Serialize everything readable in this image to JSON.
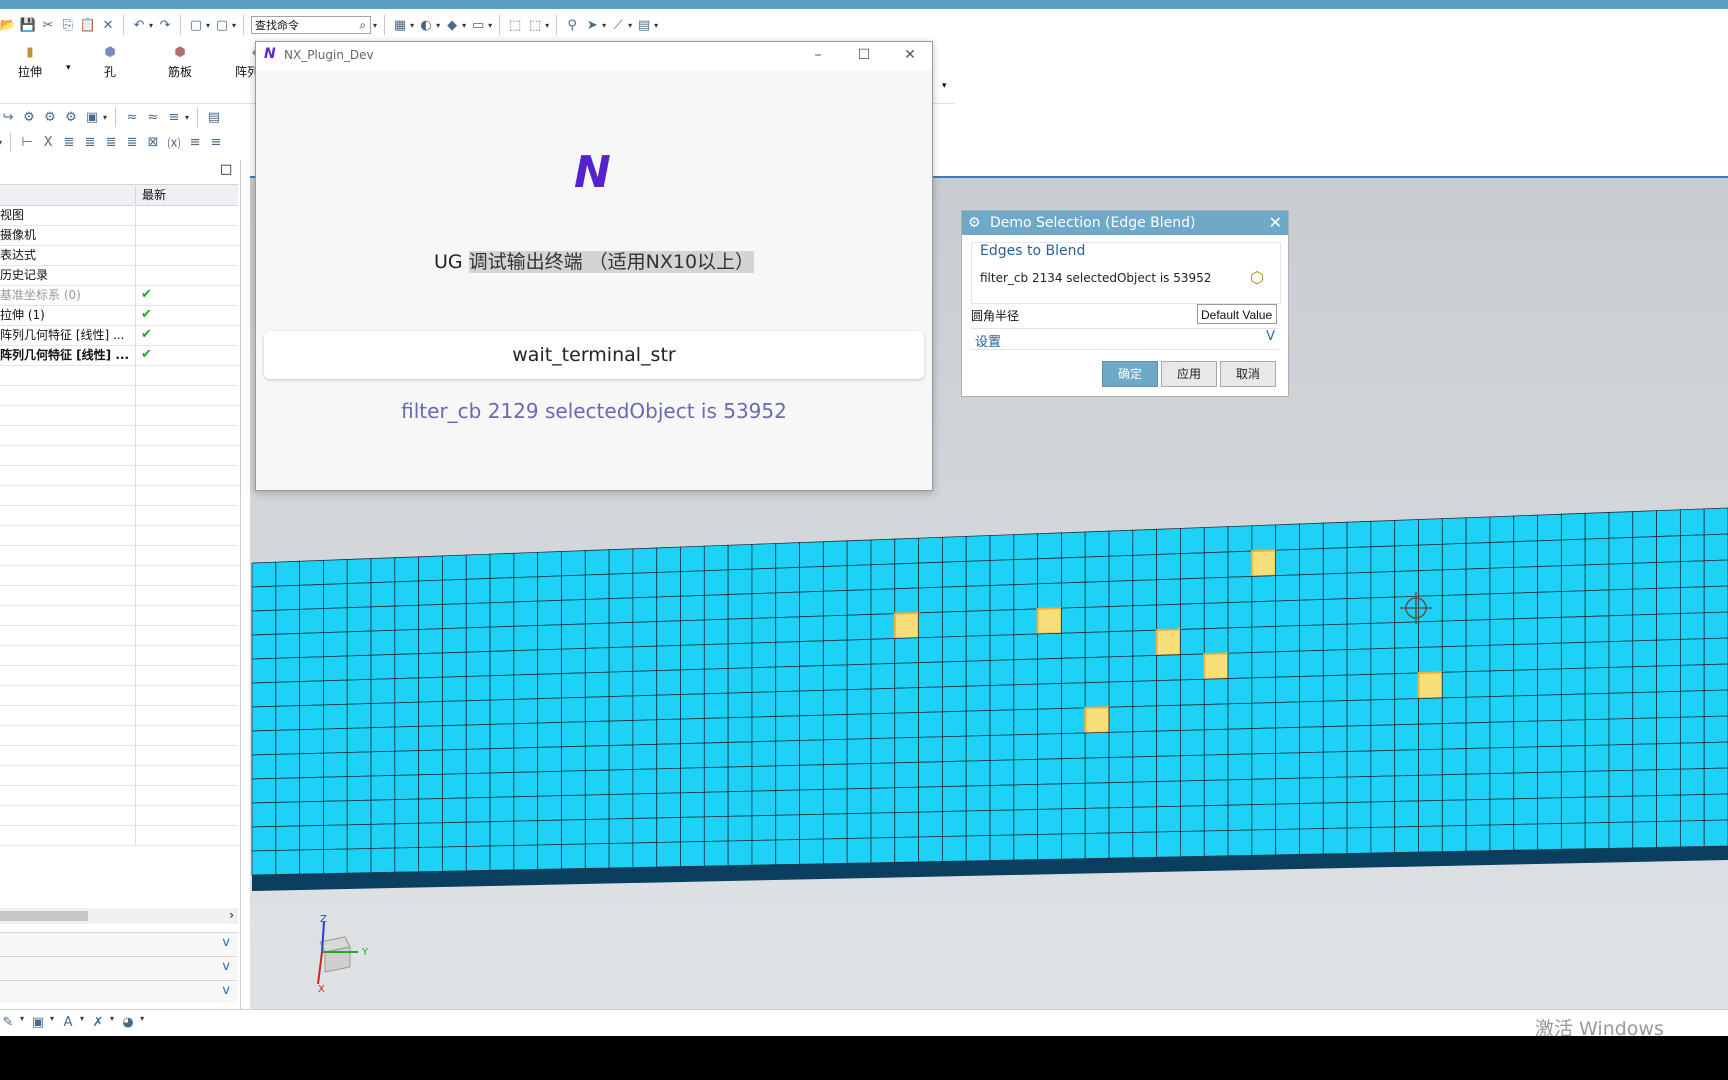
{
  "toolbar": {
    "search_value": "查找命令"
  },
  "ribbon": {
    "buttons": [
      {
        "label": "拉伸"
      },
      {
        "label": "孔"
      },
      {
        "label": "筋板"
      },
      {
        "label": "阵列"
      }
    ]
  },
  "navigator": {
    "col_latest": "最新",
    "rows": [
      {
        "label": "视图",
        "status": ""
      },
      {
        "label": "摄像机",
        "status": ""
      },
      {
        "label": "表达式",
        "status": ""
      },
      {
        "label": "历史记录",
        "status": ""
      },
      {
        "label": "基准坐标系 (0)",
        "status": "✔"
      },
      {
        "label": "拉伸 (1)",
        "status": "✔"
      },
      {
        "label": "阵列几何特征 [线性] ...",
        "status": "✔"
      },
      {
        "label": "阵列几何特征 [线性] ...",
        "status": "✔"
      }
    ]
  },
  "terminal": {
    "title": "NX_Plugin_Dev",
    "logo": "N",
    "heading_prefix": "UG ",
    "heading_highlight": "调试输出终端 （适用NX10以上）",
    "command": "wait_terminal_str",
    "output": "filter_cb 2129 selectedObject is 53952"
  },
  "dialog": {
    "title": "Demo Selection (Edge Blend)",
    "group_title": "Edges to Blend",
    "group_value": "filter_cb 2134 selectedObject is 53952",
    "radius_label": "圆角半径",
    "radius_value": "Default Value",
    "settings_label": "设置",
    "ok_label": "确定",
    "apply_label": "应用",
    "cancel_label": "取消"
  },
  "watermark": "激活 Windows",
  "colors": {
    "tile": "#1ed2f7",
    "tile_selected": "#f7de78",
    "accent": "#6fa9c9"
  }
}
